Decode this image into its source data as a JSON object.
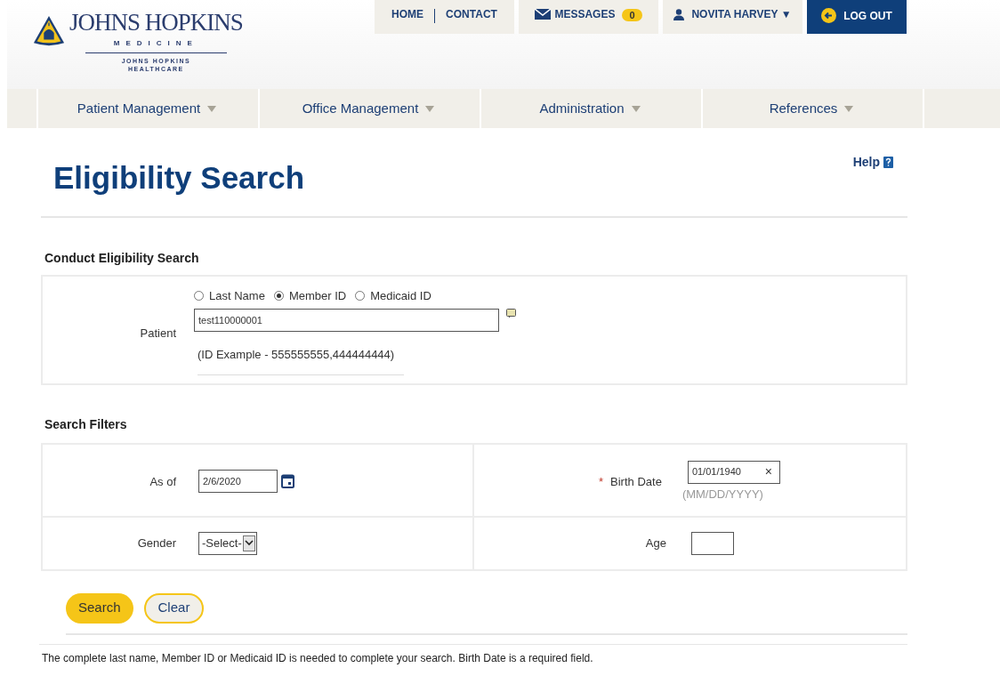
{
  "logo": {
    "name": "JOHNS HOPKINS",
    "subtitle": "MEDICINE",
    "division_line1": "JOHNS HOPKINS",
    "division_line2": "HEALTHCARE"
  },
  "top_links": [
    {
      "kind": "link",
      "label": "HOME"
    },
    {
      "kind": "link",
      "label": "CONTACT"
    }
  ],
  "messages": {
    "label": "MESSAGES",
    "count": "0"
  },
  "user": {
    "name": "NOVITA HARVEY ▼"
  },
  "logout": {
    "label": "LOG OUT"
  },
  "nav": [
    {
      "label": "Patient Management"
    },
    {
      "label": "Office Management"
    },
    {
      "label": "Administration"
    },
    {
      "label": "References"
    }
  ],
  "page_title": "Eligibility Search",
  "help": "Help",
  "conduct_section": {
    "title": "Conduct Eligibility Search",
    "label": "Patient",
    "options": [
      {
        "label": "Last Name",
        "selected": false
      },
      {
        "label": "Member ID",
        "selected": true
      },
      {
        "label": "Medicaid ID",
        "selected": false
      }
    ],
    "value": "test110000001",
    "hint": "(ID Example - 555555555,444444444)"
  },
  "filters_section": {
    "title": "Search Filters",
    "as_of": {
      "label": "As of",
      "value": "2/6/2020"
    },
    "birth_date": {
      "required_mark": "*",
      "label": "Birth Date",
      "value": "01/01/1940",
      "clear": "×",
      "hint": "(MM/DD/YYYY)"
    },
    "gender": {
      "label": "Gender",
      "value": "-Select-"
    },
    "age": {
      "label": "Age"
    }
  },
  "buttons": [
    {
      "kind": "primary",
      "label": "Search"
    },
    {
      "kind": "secondary",
      "label": "Clear"
    }
  ],
  "footer_note": "The complete last name, Member ID or Medicaid ID is needed to complete your search. Birth Date is a required field."
}
